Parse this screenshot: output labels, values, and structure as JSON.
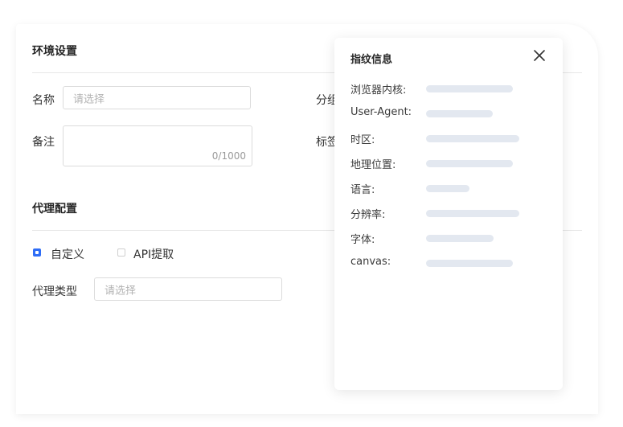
{
  "env_section": {
    "title": "环境设置",
    "name_label": "名称",
    "name_placeholder": "请选择",
    "group_label": "分组",
    "remark_label": "备注",
    "remark_counter": "0/1000",
    "tag_label": "标签"
  },
  "proxy_section": {
    "title": "代理配置",
    "options": [
      {
        "label": "自定义",
        "checked": true
      },
      {
        "label": "API提取",
        "checked": false
      }
    ],
    "type_label": "代理类型",
    "type_placeholder": "请选择"
  },
  "fingerprint_panel": {
    "title": "指纹信息",
    "close_icon": "close-icon",
    "rows": [
      {
        "label": "浏览器内核:",
        "fill": 0.72
      },
      {
        "label": "User-Agent:",
        "fill": 0.55
      },
      {
        "label": "时区:",
        "fill": 0.77
      },
      {
        "label": "地理位置:",
        "fill": 0.72
      },
      {
        "label": "语言:",
        "fill": 0.36
      },
      {
        "label": "分辨率:",
        "fill": 0.77
      },
      {
        "label": "字体:",
        "fill": 0.56
      },
      {
        "label": "canvas:",
        "fill": 0.72
      }
    ]
  },
  "colors": {
    "accent": "#2f6df6",
    "skeleton": "#e3e8f0",
    "border": "#dcdcdc"
  }
}
